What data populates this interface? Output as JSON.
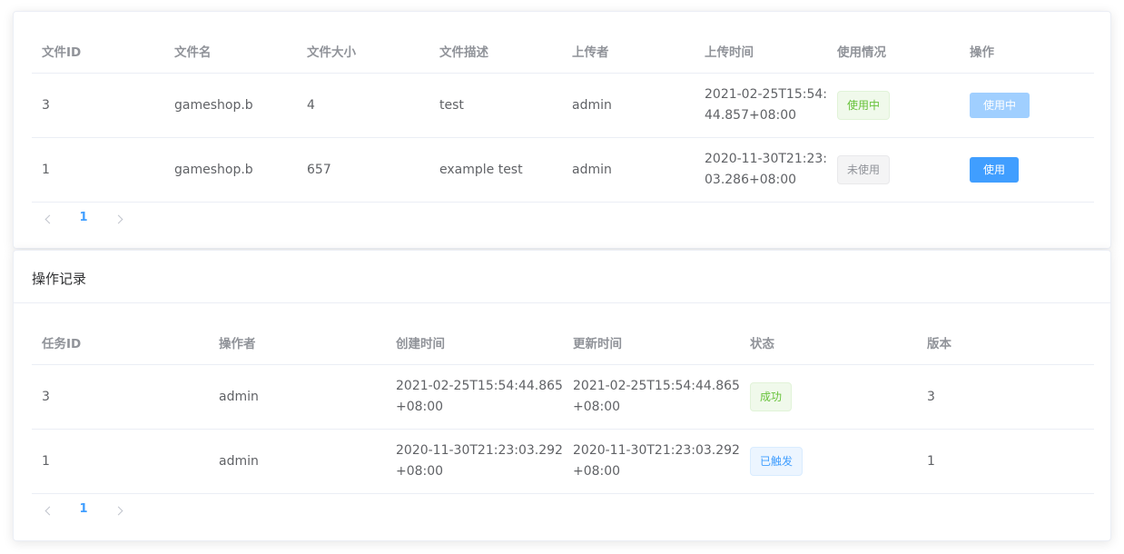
{
  "files": {
    "columns": [
      "文件ID",
      "文件名",
      "文件大小",
      "文件描述",
      "上传者",
      "上传时间",
      "使用情况",
      "操作"
    ],
    "rows": [
      {
        "id": "3",
        "name": "gameshop.b",
        "size": "4",
        "desc": "test",
        "uploader": "admin",
        "time_1": "2021-02-25T15:54:",
        "time_2": "44.857+08:00",
        "status": "使用中",
        "action": "使用中"
      },
      {
        "id": "1",
        "name": "gameshop.b",
        "size": "657",
        "desc": "example test",
        "uploader": "admin",
        "time_1": "2020-11-30T21:23:",
        "time_2": "03.286+08:00",
        "status": "未使用",
        "action": "使用"
      }
    ],
    "pagination": {
      "current_page": "1"
    }
  },
  "log": {
    "title": "操作记录",
    "columns": [
      "任务ID",
      "操作者",
      "创建时间",
      "更新时间",
      "状态",
      "版本"
    ],
    "rows": [
      {
        "id": "3",
        "operator": "admin",
        "created_1": "2021-02-25T15:54:44.865",
        "created_2": "+08:00",
        "updated_1": "2021-02-25T15:54:44.865",
        "updated_2": "+08:00",
        "status": "成功",
        "version": "3"
      },
      {
        "id": "1",
        "operator": "admin",
        "created_1": "2020-11-30T21:23:03.292",
        "created_2": "+08:00",
        "updated_1": "2020-11-30T21:23:03.292",
        "updated_2": "+08:00",
        "status": "已触发",
        "version": "1"
      }
    ],
    "pagination": {
      "current_page": "1"
    }
  },
  "colors": {
    "primary": "#409eff",
    "success": "#67c23a",
    "info": "#909399",
    "disabled_primary": "#a0cfff"
  },
  "icons": {
    "prev": "chevron-left-icon",
    "next": "chevron-right-icon"
  }
}
